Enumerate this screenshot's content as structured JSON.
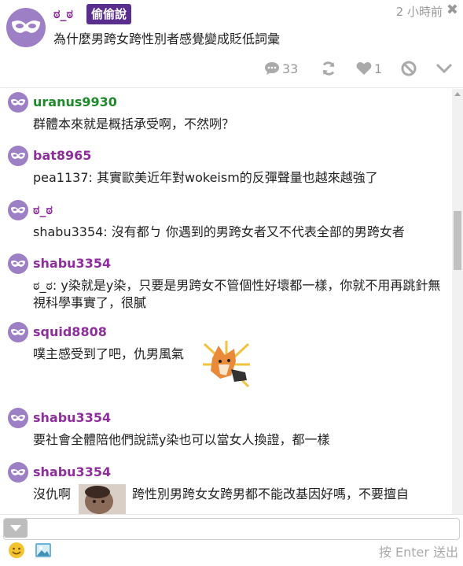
{
  "post": {
    "author": "ಠ_ಠ",
    "badge": "偷偷說",
    "title": "為什麼男跨女跨性別者感覺變成貶低詞彙",
    "time": "2 小時前",
    "comment_count": "33",
    "like_count": "1"
  },
  "comments": [
    {
      "user": "uranus9930",
      "text": "群體本來就是概括承受啊，不然咧？"
    },
    {
      "user": "bat8965",
      "text": "pea1137: 其實歐美近年對wokeism的反彈聲量也越來越強了"
    },
    {
      "user": "ಠ_ಠ",
      "text": "shabu3354: 沒有都ㄅ 你遇到的男跨女者又不代表全部的男跨女者"
    },
    {
      "user": "shabu3354",
      "text": "ಠ_ಠ: y染就是y染，只要是男跨女不管個性好壞都一樣，你就不用再跳針無視科學事實了，很膩"
    },
    {
      "user": "squid8808",
      "text": "噗主感受到了吧，仇男風氣"
    },
    {
      "user": "shabu3354",
      "text": "要社會全體陪他們說謊y染也可以當女人換證，都一樣"
    },
    {
      "user": "shabu3354",
      "text_before": "沒仇啊",
      "text_after": "跨性別男跨女女跨男都不能改基因好嗎，不要擅自"
    }
  ],
  "composer": {
    "send_hint": "按 Enter 送出"
  },
  "colors": {
    "username": "#8e2e9c",
    "username_green": "#1f8a2c",
    "badge_bg": "#5a2e8c",
    "avatar": "#9d7fc6"
  },
  "icons": [
    "mask-avatar",
    "close-icon",
    "comment-icon",
    "replurk-icon",
    "heart-icon",
    "mute-icon",
    "chevron-down-icon",
    "emoji-icon",
    "image-icon",
    "collapse-icon"
  ]
}
